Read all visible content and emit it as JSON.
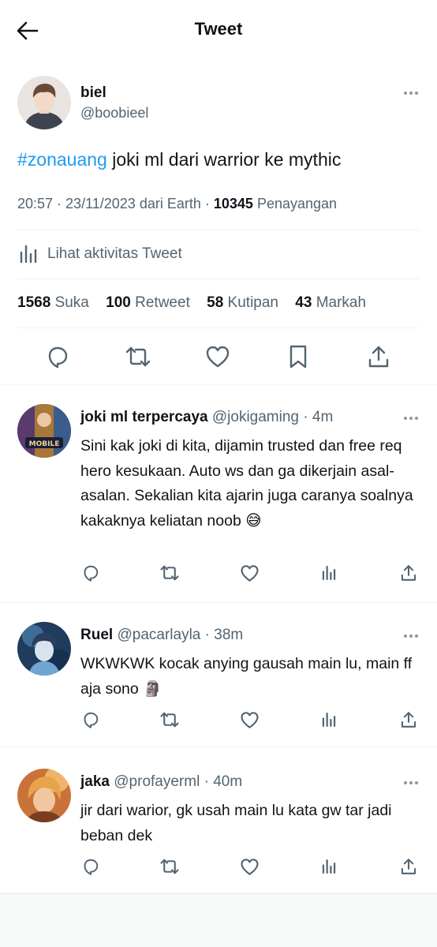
{
  "header": {
    "title": "Tweet"
  },
  "tweet": {
    "author_name": "biel",
    "author_handle": "@boobieel",
    "hashtag": "#zonauang",
    "text": " joki ml dari warrior ke mythic",
    "time": "20:57",
    "date": "23/11/2023",
    "source_prefix": "dari",
    "source": "Earth",
    "views_count": "10345",
    "views_label": "Penayangan",
    "activity_label": "Lihat aktivitas Tweet",
    "stats": [
      {
        "count": "1568",
        "label": "Suka"
      },
      {
        "count": "100",
        "label": "Retweet"
      },
      {
        "count": "58",
        "label": "Kutipan"
      },
      {
        "count": "43",
        "label": "Markah"
      }
    ]
  },
  "replies": [
    {
      "name": "joki ml terpercaya",
      "handle": "@jokigaming",
      "time": "4m",
      "text": "Sini kak joki di kita, dijamin trusted dan free req hero kesukaan. Auto ws dan ga dikerjain asal-asalan. Sekalian kita ajarin juga caranya soalnya kakaknya keliatan noob 😅"
    },
    {
      "name": "Ruel",
      "handle": "@pacarlayla",
      "time": "38m",
      "text": "WKWKWK kocak anying gausah main lu, main ff aja sono 🗿"
    },
    {
      "name": "jaka",
      "handle": "@profayerml",
      "time": "40m",
      "text": "jir dari warior, gk usah main lu kata gw tar jadi beban dek"
    }
  ],
  "colors": {
    "accent": "#1d9bf0",
    "secondary_text": "#536471",
    "divider": "#eff3f4"
  },
  "icons": [
    "back-arrow-icon",
    "more-icon",
    "bar-chart-icon",
    "reply-icon",
    "retweet-icon",
    "like-icon",
    "bookmark-icon",
    "share-icon",
    "views-icon"
  ]
}
